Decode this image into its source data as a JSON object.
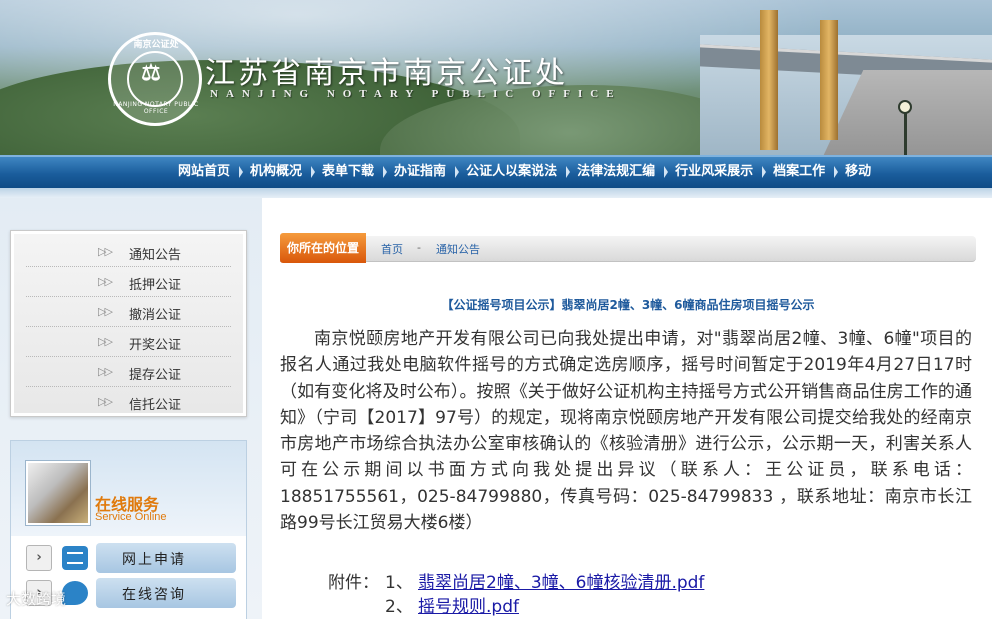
{
  "header": {
    "site_title": "江苏省南京市南京公证处",
    "site_subtitle": "NANJING NOTARY PUBLIC OFFICE",
    "seal_top_text": "南京公证处",
    "seal_ring_text": "NANJING NOTARY PUBLIC OFFICE"
  },
  "nav": {
    "items": [
      "网站首页",
      "机构概况",
      "表单下载",
      "办证指南",
      "公证人以案说法",
      "法律法规汇编",
      "行业风采展示",
      "档案工作",
      "移动"
    ]
  },
  "sidebar": {
    "menu": [
      "通知公告",
      "抵押公证",
      "撤消公证",
      "开奖公证",
      "提存公证",
      "信托公证"
    ],
    "service": {
      "title": "在线服务",
      "subtitle": "Service Online",
      "buttons": [
        "网上申请",
        "在线咨询"
      ]
    }
  },
  "breadcrumb": {
    "tag": "你所在的位置",
    "home": "首页",
    "separator": "-",
    "current": "通知公告"
  },
  "article": {
    "title": "【公证摇号项目公示】翡翠尚居2幢、3幢、6幢商品住房项目摇号公示",
    "body": "南京悦颐房地产开发有限公司已向我处提出申请，对\"翡翠尚居2幢、3幢、6幢\"项目的报名人通过我处电脑软件摇号的方式确定选房顺序，摇号时间暂定于2019年4月27日17时（如有变化将及时公布）。按照《关于做好公证机构主持摇号方式公开销售商品住房工作的通知》（宁司【2017】97号）的规定，现将南京悦颐房地产开发有限公司提交给我处的经南京市房地产市场综合执法办公室审核确认的《核验清册》进行公示，公示期一天，利害关系人可在公示期间以书面方式向我处提出异议（联系人：王公证员，联系电话：18851755561，025-84799880，传真号码：025-84799833 ，联系地址：南京市长江路99号长江贸易大楼6楼）",
    "attachments_label": "附件：",
    "attachments": [
      {
        "num": "1、",
        "name": "翡翠尚居2幢、3幢、6幢核验清册.pdf"
      },
      {
        "num": "2、",
        "name": "摇号规则.pdf"
      }
    ]
  },
  "watermark": "大数跨境"
}
